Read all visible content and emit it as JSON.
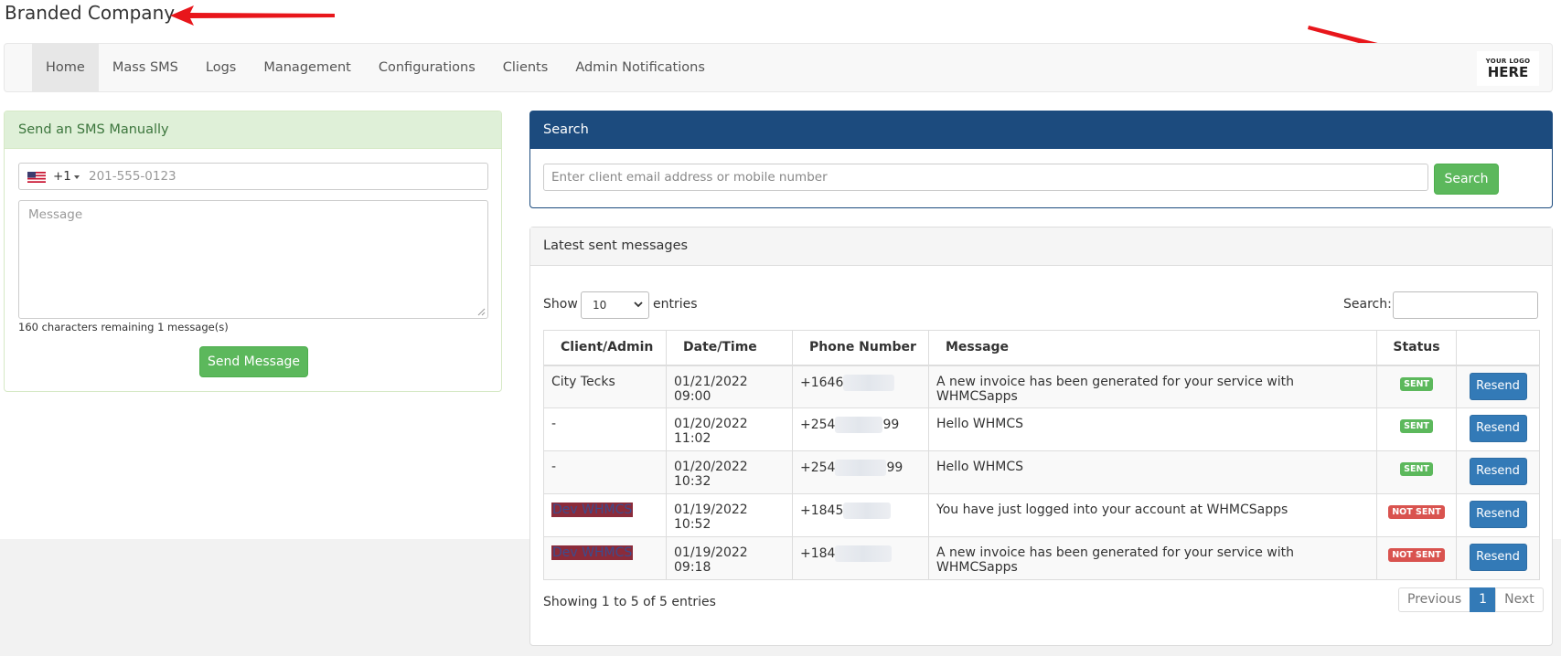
{
  "header": {
    "company_name": "Branded Company"
  },
  "nav": {
    "items": [
      {
        "label": "Home",
        "active": true
      },
      {
        "label": "Mass SMS"
      },
      {
        "label": "Logs"
      },
      {
        "label": "Management"
      },
      {
        "label": "Configurations"
      },
      {
        "label": "Clients"
      },
      {
        "label": "Admin Notifications"
      }
    ]
  },
  "logo": {
    "line1": "YOUR LOGO",
    "line2": "HERE"
  },
  "send_panel": {
    "title": "Send an SMS Manually",
    "country_code": "+1",
    "phone_placeholder": "201-555-0123",
    "message_placeholder": "Message",
    "chars_remaining": "160",
    "chars_remaining_label": "characters remaining",
    "message_count": "1",
    "message_count_label": "message(s)",
    "send_label": "Send Message"
  },
  "search_panel": {
    "title": "Search",
    "placeholder": "Enter client email address or mobile number",
    "button_label": "Search"
  },
  "latest_panel": {
    "title": "Latest sent messages",
    "show_label": "Show",
    "page_length": "10",
    "entries_label": "entries",
    "filter_label": "Search:",
    "columns": [
      "Client/Admin",
      "Date/Time",
      "Phone Number",
      "Message",
      "Status",
      ""
    ],
    "rows": [
      {
        "client": "City Tecks",
        "datetime": "01/21/2022 09:00",
        "phone_prefix": "+1646",
        "phone_suffix": "",
        "message": "A new invoice has been generated for your service with WHMCSapps",
        "status": "SENT",
        "action": "Resend"
      },
      {
        "client": "-",
        "datetime": "01/20/2022 11:02",
        "phone_prefix": "+254",
        "phone_suffix": "99",
        "message": "Hello WHMCS",
        "status": "SENT",
        "action": "Resend"
      },
      {
        "client": "-",
        "datetime": "01/20/2022 10:32",
        "phone_prefix": "+254",
        "phone_suffix": "99",
        "message": "Hello WHMCS",
        "status": "SENT",
        "action": "Resend"
      },
      {
        "client": "Dev WHMCS",
        "datetime": "01/19/2022 10:52",
        "phone_prefix": "+1845",
        "phone_suffix": "",
        "message": "You have just logged into your account at WHMCSapps",
        "status": "NOT SENT",
        "action": "Resend"
      },
      {
        "client": "Dev WHMCS",
        "datetime": "01/19/2022 09:18",
        "phone_prefix": "+184",
        "phone_suffix": "",
        "message": "A new invoice has been generated for your service with WHMCSapps",
        "status": "NOT SENT",
        "action": "Resend"
      }
    ],
    "info": "Showing 1 to 5 of 5 entries",
    "pagination": {
      "previous": "Previous",
      "current": "1",
      "next": "Next"
    }
  },
  "colors": {
    "sent_badge": "#5cb85c",
    "not_sent_badge": "#d9534f",
    "primary_button": "#337ab7",
    "success_button": "#5cb85c",
    "search_header": "#1c4b7e"
  }
}
